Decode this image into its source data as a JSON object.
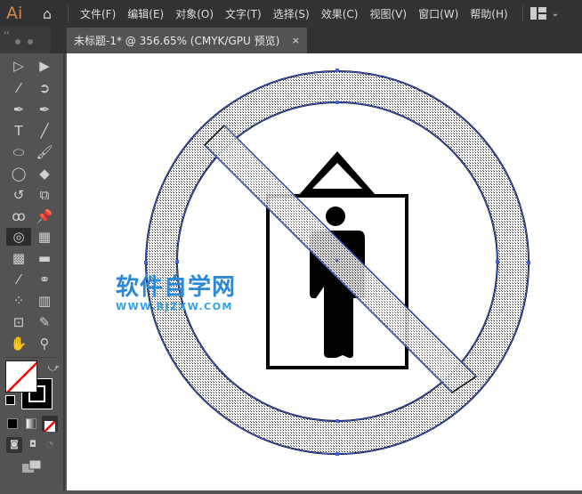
{
  "app": {
    "logo": "Ai"
  },
  "menu": [
    "文件(F)",
    "编辑(E)",
    "对象(O)",
    "文字(T)",
    "选择(S)",
    "效果(C)",
    "视图(V)",
    "窗口(W)",
    "帮助(H)"
  ],
  "tab": {
    "title": "未标题-1* @ 356.65% (CMYK/GPU 预览)",
    "close": "×"
  },
  "toolbar": {
    "collapse": "‹‹"
  },
  "watermark": {
    "cn": "软件自学网",
    "en": "WWW.RJZXW.COM"
  },
  "colors": {
    "accent": "#2a88d6",
    "selection": "#4060e0"
  }
}
